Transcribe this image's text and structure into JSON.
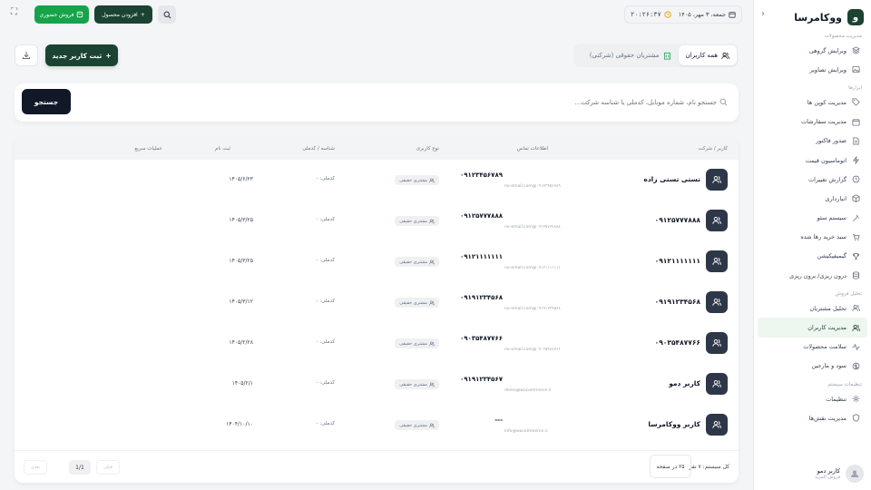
{
  "sidebar": {
    "brand": "ووکامرسا",
    "brand_letter": "و",
    "groups": [
      {
        "title": "مدیریت محصولات",
        "items": [
          {
            "label": "ویرایش گروهی",
            "icon": "layers-icon"
          },
          {
            "label": "ویرایش تصاویر",
            "icon": "image-icon"
          }
        ]
      },
      {
        "title": "ابزارها",
        "items": [
          {
            "label": "مدیریت کوپن ها",
            "icon": "tag-icon"
          },
          {
            "label": "مدیریت سفارشات",
            "icon": "calendar-icon"
          },
          {
            "label": "صدور فاکتور",
            "icon": "file-icon"
          },
          {
            "label": "اتوماسیون قیمت",
            "icon": "bolt-icon"
          },
          {
            "label": "گزارش تغییرات",
            "icon": "history-icon"
          },
          {
            "label": "انبارداری",
            "icon": "box-icon"
          },
          {
            "label": "سیستم سئو",
            "icon": "wand-icon"
          },
          {
            "label": "سبد خرید رها شده",
            "icon": "cart-icon"
          },
          {
            "label": "گیمیفیکیشن",
            "icon": "trophy-icon"
          },
          {
            "label": "درون ریزی/ برون ریزی",
            "icon": "database-icon"
          }
        ]
      },
      {
        "title": "تحلیل فروش",
        "items": [
          {
            "label": "تحلیل مشتریان",
            "icon": "users-icon"
          },
          {
            "label": "مدیریت کاربران",
            "icon": "users-icon",
            "active": true
          },
          {
            "label": "سلامت محصولات",
            "icon": "pulse-icon"
          },
          {
            "label": "سود و مارجین",
            "icon": "coins-icon"
          }
        ]
      },
      {
        "title": "تنظیمات سیستم",
        "items": [
          {
            "label": "تنظیمات",
            "icon": "gear-icon"
          },
          {
            "label": "مدیریت نقش‌ها",
            "icon": "shield-icon"
          }
        ]
      }
    ],
    "user": {
      "name": "کاربر دمو",
      "role": "فروش المزید"
    }
  },
  "topbar": {
    "date": "جمعه، ۳ مهر، ۱۴۰۵",
    "time": "۲۰:۲۶:۳۷",
    "add_product": "افزودن محصول",
    "pos": "فروش حضوری"
  },
  "tabs": [
    {
      "label": "همه کاربران",
      "active": true
    },
    {
      "label": "مشتریان حقوقی (شرکتی)",
      "active": false
    }
  ],
  "actions": {
    "new_user": "ثبت کاربر جدید"
  },
  "search": {
    "placeholder": "جستجو نام، شماره موبایل، کدملی یا شناسه شرکت...",
    "button": "جستجو"
  },
  "table": {
    "headers": {
      "user": "کاربر / شرکت",
      "contact": "اطلاعات تماس",
      "type": "نوع کاربری",
      "id": "شناسه / کدملی",
      "registered": "ثبت نام",
      "actions": "عملیات سریع"
    },
    "rows": [
      {
        "name": "تستی تستی زاده",
        "phone": "۰۹۱۲۳۴۵۶۷۸۹",
        "email": "no-email.com@۰۹۱۲۳۴۵۶۷۸۹",
        "type": "مشتری حقیقی",
        "nid": "کدملی: -",
        "reg": "۱۴۰۵/۶/۲۳"
      },
      {
        "name": "۰۹۱۲۵۷۷۷۸۸۸",
        "phone": "۰۹۱۲۵۷۷۷۸۸۸",
        "email": "no-email.com@۰۹۱۲۵۷۷۷۸۸۸",
        "type": "مشتری حقیقی",
        "nid": "کدملی: -",
        "reg": "۱۴۰۵/۳/۲۵"
      },
      {
        "name": "۰۹۱۲۱۱۱۱۱۱۱",
        "phone": "۰۹۱۲۱۱۱۱۱۱۱",
        "email": "no-email.com@۰۹۱۲۱۱۱۱۱۱۱",
        "type": "مشتری حقیقی",
        "nid": "کدملی: -",
        "reg": "۱۴۰۵/۳/۲۵"
      },
      {
        "name": "۰۹۱۹۱۲۳۴۵۶۸",
        "phone": "۰۹۱۹۱۲۳۴۵۶۸",
        "email": "no-email.com@۰۹۱۹۱۲۳۴۵۶۸",
        "type": "مشتری حقیقی",
        "nid": "کدملی: -",
        "reg": "۱۴۰۵/۳/۱۲"
      },
      {
        "name": "۰۹۰۳۵۴۸۷۷۶۶",
        "phone": "۰۹۰۳۵۴۸۷۷۶۶",
        "email": "no-email.com@۰۹۰۳۵۴۸۷۷۶۶",
        "type": "مشتری حقیقی",
        "nid": "کدملی: -",
        "reg": "۱۴۰۵/۲/۲۸"
      },
      {
        "name": "کاربر دمو",
        "phone": "۰۹۱۹۱۲۳۴۵۶۷",
        "email": "demo@wocommerce.ir",
        "type": "مشتری حقیقی",
        "nid": "کدملی: -",
        "reg": "۱۴۰۵/۲/۱"
      },
      {
        "name": "کاربر ووکامرسا",
        "phone": "---",
        "email": "info@wocommerce.ir",
        "type": "مشتری حقیقی",
        "nid": "کدملی: -",
        "reg": "۱۴۰۴/۱۰/۱۰"
      }
    ]
  },
  "pager": {
    "total": "کل سیستم: ۷ نفر",
    "per_page": "۲۵ در صفحه",
    "prev": "قبلی",
    "page": "1/1",
    "next": "بعدی"
  }
}
